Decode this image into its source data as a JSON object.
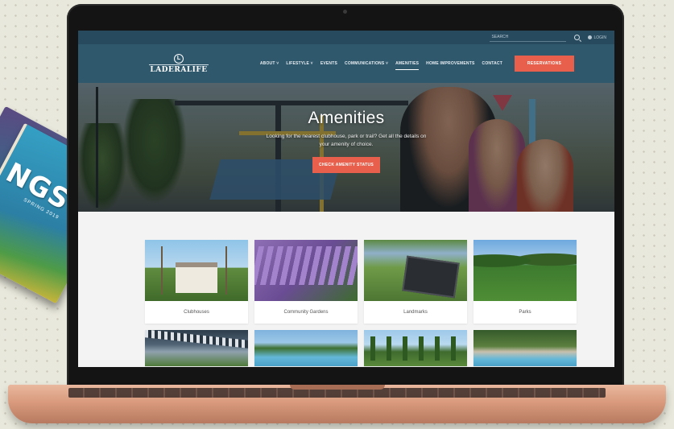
{
  "magazine": {
    "title": "NGS",
    "subtitle": "SPRING 2019"
  },
  "top_bar": {
    "search_placeholder": "SEARCH",
    "login_label": "LOGIN"
  },
  "nav": {
    "logo_text": "LADERALIFE",
    "logo_mark": "L",
    "items": [
      {
        "label": "ABOUT ˅"
      },
      {
        "label": "LIFESTYLE ˅"
      },
      {
        "label": "EVENTS"
      },
      {
        "label": "COMMUNICATIONS ˅"
      },
      {
        "label": "AMENITIES"
      },
      {
        "label": "HOME IMPROVEMENTS"
      },
      {
        "label": "CONTACT"
      }
    ],
    "active_item": "AMENITIES",
    "reserve_label": "RESERVATIONS"
  },
  "hero": {
    "title": "Amenities",
    "subtitle": "Looking for the nearest clubhouse, park or trail? Get all the details on your amenity of choice.",
    "button_label": "CHECK AMENITY STATUS"
  },
  "cards": [
    {
      "label": "Clubhouses"
    },
    {
      "label": "Community Gardens"
    },
    {
      "label": "Landmarks"
    },
    {
      "label": "Parks"
    },
    {
      "label": ""
    },
    {
      "label": ""
    },
    {
      "label": ""
    },
    {
      "label": ""
    }
  ],
  "colors": {
    "top_bar": "#274a5e",
    "nav_bar": "#2f586d",
    "accent": "#e8604c",
    "laptop_rose_gold": "#d99a7d"
  }
}
